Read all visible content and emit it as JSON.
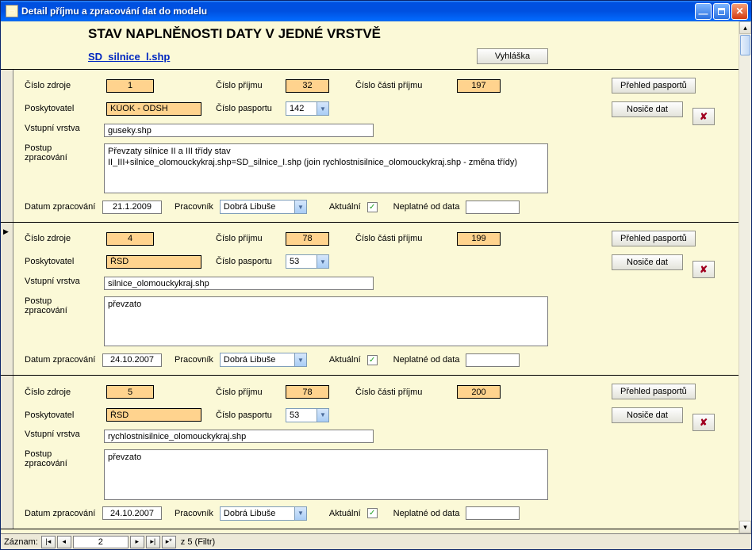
{
  "window": {
    "title": "Detail příjmu a zpracování dat do modelu"
  },
  "header": {
    "title": "STAV NAPLNĚNOSTI DATY V JEDNÉ VRSTVĚ",
    "fileLink": "SD_silnice_l.shp",
    "btnVyhlaska": "Vyhláška"
  },
  "labels": {
    "cisloZdroje": "Číslo zdroje",
    "cisloPrijmu": "Číslo příjmu",
    "cisloCastiPrijmu": "Číslo části příjmu",
    "poskytovatel": "Poskytovatel",
    "cisloPasportu": "Číslo pasportu",
    "vstupniVrstva": "Vstupní vrstva",
    "postupZpracovani": "Postup zpracování",
    "datumZpracovani": "Datum zpracování",
    "pracovnik": "Pracovník",
    "aktualni": "Aktuální",
    "neplatneOdData": "Neplatné od data",
    "prehledPasportu": "Přehled pasportů",
    "nosiceDat": "Nosiče dat"
  },
  "records": [
    {
      "cisloZdroje": "1",
      "cisloPrijmu": "32",
      "cisloCastiPrijmu": "197",
      "poskytovatel": "KÚOK - ODSH",
      "cisloPasportu": "142",
      "vstupniVrstva": "guseky.shp",
      "postup": "Převzaty silnice II a III třídy stav\nII_III+silnice_olomouckykraj.shp=SD_silnice_I.shp (join rychlostnisilnice_olomouckykraj.shp - změna třídy)",
      "datum": "21.1.2009",
      "pracovnik": "Dobrá Libuše",
      "aktualni": true,
      "neplatne": "",
      "selected": false
    },
    {
      "cisloZdroje": "4",
      "cisloPrijmu": "78",
      "cisloCastiPrijmu": "199",
      "poskytovatel": "ŘSD",
      "cisloPasportu": "53",
      "vstupniVrstva": "silnice_olomouckykraj.shp",
      "postup": "převzato",
      "datum": "24.10.2007",
      "pracovnik": "Dobrá Libuše",
      "aktualni": true,
      "neplatne": "",
      "selected": true
    },
    {
      "cisloZdroje": "5",
      "cisloPrijmu": "78",
      "cisloCastiPrijmu": "200",
      "poskytovatel": "ŘSD",
      "cisloPasportu": "53",
      "vstupniVrstva": "rychlostnisilnice_olomouckykraj.shp",
      "postup": "převzato",
      "datum": "24.10.2007",
      "pracovnik": "Dobrá Libuše",
      "aktualni": true,
      "neplatne": "",
      "selected": false
    }
  ],
  "status": {
    "label": "Záznam:",
    "current": "2",
    "total": "z  5 (Filtr)"
  }
}
